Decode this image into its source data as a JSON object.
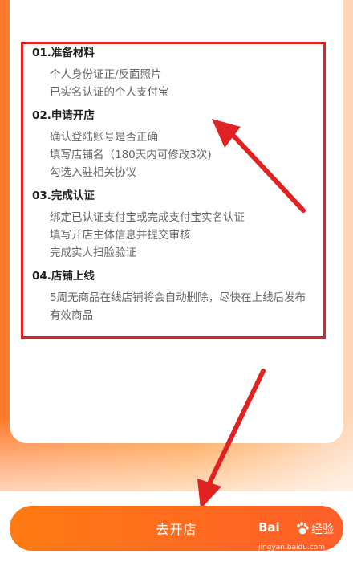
{
  "steps": [
    {
      "title": "01.准备材料",
      "lines": [
        "个人身份证正/反面照片",
        "已实名认证的个人支付宝"
      ]
    },
    {
      "title": "02.申请开店",
      "lines": [
        "确认登陆账号是否正确",
        "填写店铺名（180天内可修改3次)",
        "勾选入驻相关协议"
      ]
    },
    {
      "title": "03.完成认证",
      "lines": [
        "绑定已认证支付宝或完成支付宝实名认证",
        "填写开店主体信息并提交审核",
        "完成实人扫脸验证"
      ]
    },
    {
      "title": "04.店铺上线",
      "lines": [
        "5周无商品在线店铺将会自动删除，尽快在上线后发布",
        "有效商品"
      ]
    }
  ],
  "cta": {
    "label": "去开店"
  },
  "watermark": {
    "logo": "Bai",
    "brand": "经验",
    "url": "jingyan.baidu.com"
  },
  "colors": {
    "accent": "#ff7a2a",
    "annotation_red": "#e12222"
  }
}
